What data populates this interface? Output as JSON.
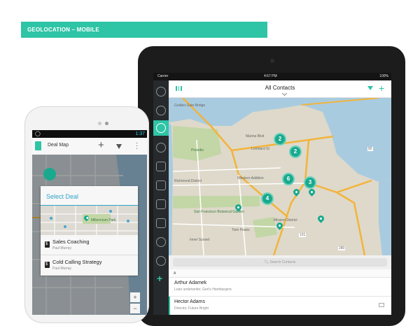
{
  "banner": {
    "title": "GEOLOCATION – MOBILE"
  },
  "tablet": {
    "status": {
      "carrier": "Carrier",
      "time": "4:57 PM",
      "battery": "100%"
    },
    "header": {
      "title": "All Contacts"
    },
    "map": {
      "labels": {
        "presidio": "Presidio",
        "marina": "Marina Blvd",
        "lombard": "Lombard St",
        "richmond": "Richmond District",
        "western": "Western Addition",
        "park": "San Francisco Botanical Garden",
        "sunset": "Inner Sunset",
        "twin": "Twin Peaks",
        "mission": "Mission District",
        "hwy1": "101",
        "hwy2": "280",
        "east1": "80",
        "ggb": "Golden Gate Bridge"
      },
      "clusters": [
        "2",
        "2",
        "6",
        "3",
        "4"
      ]
    },
    "search": {
      "placeholder": "Search Contacts"
    },
    "section": "A",
    "contacts": [
      {
        "name": "Arthur Adamek",
        "detail": "Loan underwriter, Geri's Hamburgers"
      },
      {
        "name": "Hector Adams",
        "detail": "Director, Future Bright"
      }
    ]
  },
  "phone": {
    "status": {
      "time": "1:37"
    },
    "toolbar": {
      "title": "Deal Map"
    },
    "fab": "",
    "dialog": {
      "title": "Select Deal",
      "map_label": "Millennium Park",
      "deals": [
        {
          "name": "Sales Coaching",
          "owner": "Paul Murray"
        },
        {
          "name": "Cold Calling Strategy",
          "owner": "Paul Murray"
        }
      ]
    },
    "zoom": {
      "in": "+",
      "out": "−"
    }
  },
  "colors": {
    "accent": "#2ec4a6",
    "cluster": "#1aa98e",
    "dialog_title": "#2ea4c9"
  }
}
